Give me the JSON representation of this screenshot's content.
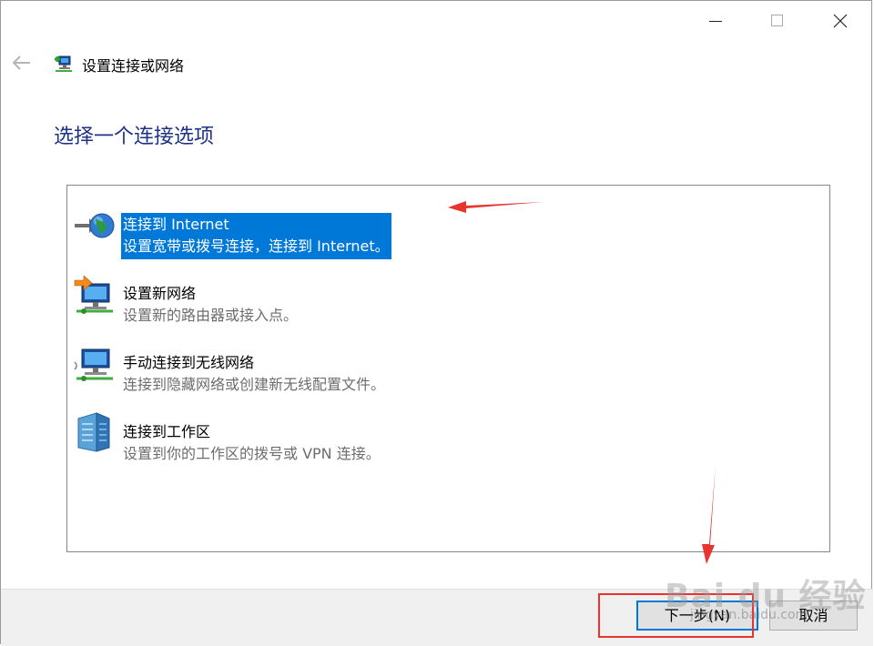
{
  "window": {
    "title": "设置连接或网络"
  },
  "main": {
    "heading": "选择一个连接选项",
    "options": [
      {
        "title": "连接到 Internet",
        "description": "设置宽带或拨号连接，连接到 Internet。",
        "selected": true,
        "icon": "globe-connect-icon"
      },
      {
        "title": "设置新网络",
        "description": "设置新的路由器或接入点。",
        "selected": false,
        "icon": "new-network-icon"
      },
      {
        "title": "手动连接到无线网络",
        "description": "连接到隐藏网络或创建新无线配置文件。",
        "selected": false,
        "icon": "wireless-network-icon"
      },
      {
        "title": "连接到工作区",
        "description": "设置到你的工作区的拨号或 VPN 连接。",
        "selected": false,
        "icon": "workplace-building-icon"
      }
    ]
  },
  "buttons": {
    "next": "下一步(N)",
    "cancel": "取消"
  },
  "watermark": {
    "brand": "Bai du 经验",
    "url": "jingyan.baidu.com"
  },
  "colors": {
    "heading": "#1e3287",
    "selection": "#0078d7",
    "annotation": "#e8332e"
  }
}
